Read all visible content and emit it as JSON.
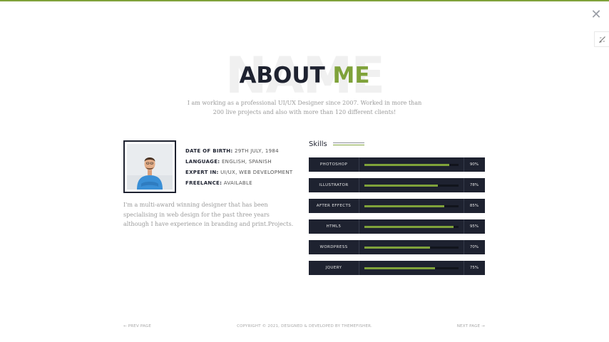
{
  "theme": {
    "accent": "#7fa23a",
    "dark": "#1e2230",
    "muted": "#9b9b9b"
  },
  "header": {
    "close_label": "✕",
    "close_icon": "close-icon",
    "tool_icon": "paint-brush-icon"
  },
  "about": {
    "background_word": "NAME",
    "title_main": "ABOUT",
    "title_accent": "ME",
    "intro": "I am working as a professional UI/UX Designer since 2007. Worked in more than 200 live projects and also with more than 120 different clients!"
  },
  "profile": {
    "photo_icon": "profile-photo",
    "facts": [
      {
        "key": "DATE OF BIRTH:",
        "value": "29TH JULY, 1984"
      },
      {
        "key": "LANGUAGE:",
        "value": "ENGLISH, SPANISH"
      },
      {
        "key": "EXPERT IN:",
        "value": "UI/UX, WEB DEVELOPMENT"
      },
      {
        "key": "FREELANCE:",
        "value": "AVAILABLE"
      }
    ],
    "bio": "I'm a multi-award winning designer that has been specialising in web design for the past three years although I have experience in branding and print.Projects."
  },
  "skills": {
    "title": "Skills",
    "items": [
      {
        "name": "PHOTOSHOP",
        "percent": 90,
        "label": "90%"
      },
      {
        "name": "ILLUSTRATOR",
        "percent": 78,
        "label": "78%"
      },
      {
        "name": "AFTER EFFECTS",
        "percent": 85,
        "label": "85%"
      },
      {
        "name": "HTML5",
        "percent": 95,
        "label": "95%"
      },
      {
        "name": "WORDPRESS",
        "percent": 70,
        "label": "70%"
      },
      {
        "name": "JQUERY",
        "percent": 75,
        "label": "75%"
      }
    ]
  },
  "footer": {
    "prev": "← PREV PAGE",
    "copyright": "COPYRIGHT © 2021, DESIGNED & DEVELOPED BY THEMEFISHER.",
    "next": "NEXT PAGE →"
  }
}
